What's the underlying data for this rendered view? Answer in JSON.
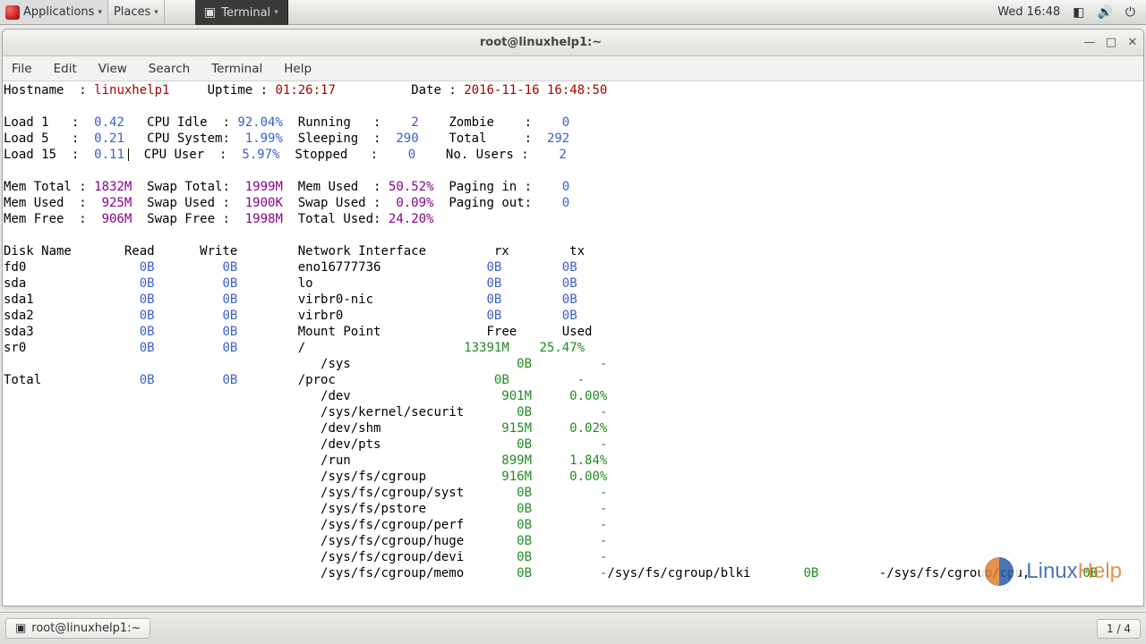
{
  "topbar": {
    "applications": "Applications",
    "places": "Places",
    "terminal": "Terminal",
    "clock": "Wed 16:48"
  },
  "window": {
    "title": "root@linuxhelp1:~",
    "menus": [
      "File",
      "Edit",
      "View",
      "Search",
      "Terminal",
      "Help"
    ]
  },
  "header": {
    "hostname_label": "Hostname  : ",
    "hostname": "linuxhelp1",
    "uptime_label": "Uptime : ",
    "uptime": "01:26:17",
    "date_label": "Date : ",
    "date": "2016-11-16 16:48:50"
  },
  "stats": {
    "load1_l": "Load 1   :  ",
    "load1": "0.42",
    "load5_l": "Load 5   :  ",
    "load5": "0.21",
    "load15_l": "Load 15  :  ",
    "load15": "0.11",
    "cpui_l": "CPU Idle  : ",
    "cpui": "92.04%",
    "cpus_l": "CPU System: ",
    "cpus": " 1.99%",
    "cpuu_l": "CPU User  : ",
    "cpuu": " 5.97%",
    "run_l": "Running   :    ",
    "run": "2",
    "slp_l": "Sleeping  :  ",
    "slp": "290",
    "stp_l": "Stopped   :    ",
    "stp": "0",
    "zom_l": "Zombie    :    ",
    "zom": "0",
    "tot_l": "Total     :  ",
    "tot": "292",
    "usr_l": "No. Users :    ",
    "usr": "2"
  },
  "mem": {
    "mt_l": "Mem Total : ",
    "mt": "1832M",
    "mu_l": "Mem Used  :  ",
    "mu": "925M",
    "mf_l": "Mem Free  :  ",
    "mf": "906M",
    "st_l": "Swap Total:  ",
    "st": "1999M",
    "su_l": "Swap Used :  ",
    "su": "1900K",
    "sf_l": "Swap Free :  ",
    "sf": "1998M",
    "xu_l": "Mem Used  : ",
    "xu": "50.52%",
    "xs_l": "Swap Used :  ",
    "xs": "0.09%",
    "xt_l": "Total Used: ",
    "xt": "24.20%",
    "pi_l": "Paging in :    ",
    "pi": "0",
    "po_l": "Paging out:    ",
    "po": "0"
  },
  "disk_hdr": {
    "a": "Disk Name       Read      Write",
    "b": "Network Interface         rx        tx"
  },
  "disks": [
    {
      "n": "fd0  ",
      "r": "0B",
      "w": "0B"
    },
    {
      "n": "sda  ",
      "r": "0B",
      "w": "0B"
    },
    {
      "n": "sda1 ",
      "r": "0B",
      "w": "0B"
    },
    {
      "n": "sda2 ",
      "r": "0B",
      "w": "0B"
    },
    {
      "n": "sda3 ",
      "r": "0B",
      "w": "0B"
    },
    {
      "n": "sr0  ",
      "r": "0B",
      "w": "0B"
    }
  ],
  "disk_total": {
    "n": "Total",
    "r": "0B",
    "w": "0B"
  },
  "nets": [
    {
      "n": "eno16777736",
      "r": "0B",
      "t": "0B"
    },
    {
      "n": "lo         ",
      "r": "0B",
      "t": "0B"
    },
    {
      "n": "virbr0-nic ",
      "r": "0B",
      "t": "0B"
    },
    {
      "n": "virbr0     ",
      "r": "0B",
      "t": "0B"
    }
  ],
  "mount_hdr": {
    "a": "Mount Point              Free      Used"
  },
  "mounts": [
    {
      "p": "/                   ",
      "f": "13391M",
      "u": "25.47%"
    },
    {
      "p": "/sys                ",
      "f": "    0B",
      "u": "     -"
    },
    {
      "p": "/proc               ",
      "f": "    0B",
      "u": "     -"
    },
    {
      "p": "/dev                ",
      "f": "  901M",
      "u": " 0.00%"
    },
    {
      "p": "/sys/kernel/securit ",
      "f": "    0B",
      "u": "     -"
    },
    {
      "p": "/dev/shm            ",
      "f": "  915M",
      "u": " 0.02%"
    },
    {
      "p": "/dev/pts            ",
      "f": "    0B",
      "u": "     -"
    },
    {
      "p": "/run                ",
      "f": "  899M",
      "u": " 1.84%"
    },
    {
      "p": "/sys/fs/cgroup      ",
      "f": "  916M",
      "u": " 0.00%"
    },
    {
      "p": "/sys/fs/cgroup/syst ",
      "f": "    0B",
      "u": "     -"
    },
    {
      "p": "/sys/fs/pstore      ",
      "f": "    0B",
      "u": "     -"
    },
    {
      "p": "/sys/fs/cgroup/perf ",
      "f": "    0B",
      "u": "     -"
    },
    {
      "p": "/sys/fs/cgroup/huge ",
      "f": "    0B",
      "u": "     -"
    },
    {
      "p": "/sys/fs/cgroup/devi ",
      "f": "    0B",
      "u": "     -"
    },
    {
      "p": "/sys/fs/cgroup/memo ",
      "f": "    0B",
      "u": "     -"
    }
  ],
  "overflow": {
    "a": "/sys/fs/cgroup/blki",
    "af": "0B",
    "b": "/sys/fs/cgroup/cpu,",
    "bf": "0B"
  },
  "taskbar": {
    "btn": "root@linuxhelp1:~",
    "pager": "1 / 4"
  },
  "logo": {
    "a": "Linux",
    "b": "Help"
  }
}
